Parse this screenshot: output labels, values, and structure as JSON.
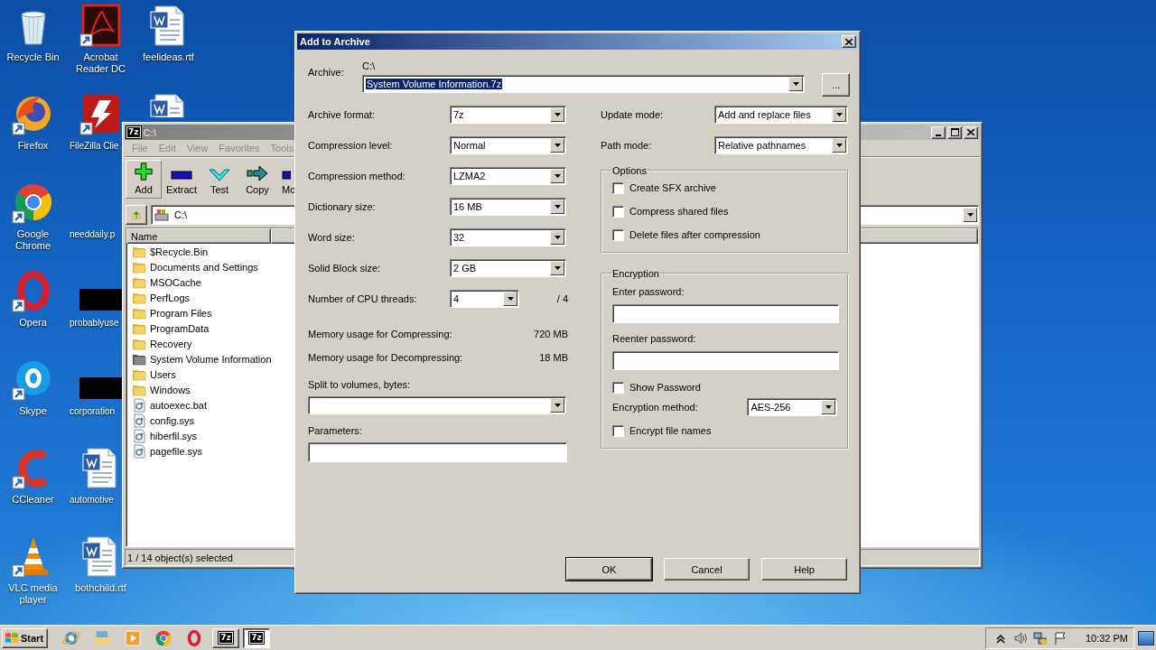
{
  "desktop_icons": [
    {
      "label": "Recycle Bin",
      "kind": "recycle-bin",
      "shortcut": false
    },
    {
      "label": "Firefox",
      "kind": "firefox",
      "shortcut": true
    },
    {
      "label": "Google Chrome",
      "kind": "chrome",
      "shortcut": true
    },
    {
      "label": "Opera",
      "kind": "opera",
      "shortcut": true
    },
    {
      "label": "Skype",
      "kind": "skype",
      "shortcut": true
    },
    {
      "label": "CCleaner",
      "kind": "ccleaner",
      "shortcut": true
    },
    {
      "label": "VLC media player",
      "kind": "vlc",
      "shortcut": true
    },
    {
      "label": "Acrobat Reader DC",
      "kind": "acrobat",
      "shortcut": true
    },
    {
      "label": "FileZilla Clie",
      "kind": "filezilla",
      "shortcut": true,
      "cut": true
    },
    {
      "label": "needdaily.p",
      "cut": true
    },
    {
      "label": "probablyuse",
      "kind": "redacted",
      "cut": true
    },
    {
      "label": "corporation",
      "kind": "redacted",
      "cut": true
    },
    {
      "label": "automotive",
      "kind": "word",
      "shortcut": false,
      "cut": true
    },
    {
      "label": "bothchild.rtf",
      "kind": "word",
      "shortcut": false
    },
    {
      "label": "feelideas.rtf",
      "kind": "word",
      "shortcut": false
    },
    {
      "kind": "word",
      "shortcut": false,
      "cut": true
    }
  ],
  "file_manager": {
    "logo": "7z",
    "title": "C:\\",
    "menu": [
      "File",
      "Edit",
      "View",
      "Favorites",
      "Tools"
    ],
    "toolbar": [
      {
        "label": "Add",
        "kind": "add",
        "selected": true
      },
      {
        "label": "Extract",
        "kind": "extract",
        "selected": false
      },
      {
        "label": "Test",
        "kind": "test",
        "selected": false
      },
      {
        "label": "Copy",
        "kind": "copy",
        "selected": false
      },
      {
        "label": "Mo",
        "kind": "move",
        "selected": false,
        "cut": true
      }
    ],
    "address": "C:\\",
    "columns": [
      "Name"
    ],
    "files": [
      {
        "name": "$Recycle.Bin",
        "kind": "folder"
      },
      {
        "name": "Documents and Settings",
        "kind": "folder"
      },
      {
        "name": "MSOCache",
        "kind": "folder"
      },
      {
        "name": "PerfLogs",
        "kind": "folder"
      },
      {
        "name": "Program Files",
        "kind": "folder"
      },
      {
        "name": "ProgramData",
        "kind": "folder"
      },
      {
        "name": "Recovery",
        "kind": "folder"
      },
      {
        "name": "System Volume Information",
        "kind": "system-folder"
      },
      {
        "name": "Users",
        "kind": "folder"
      },
      {
        "name": "Windows",
        "kind": "folder"
      },
      {
        "name": "autoexec.bat",
        "kind": "file"
      },
      {
        "name": "config.sys",
        "kind": "file"
      },
      {
        "name": "hiberfil.sys",
        "kind": "file"
      },
      {
        "name": "pagefile.sys",
        "kind": "file"
      }
    ],
    "status": "1 / 14 object(s) selected"
  },
  "dialog": {
    "title": "Add to Archive",
    "archive": {
      "label": "Archive:",
      "folder": "C:\\",
      "value": "System Volume Information.7z",
      "browse": "..."
    },
    "left_fields": [
      {
        "label": "Archive format:",
        "value": "7z"
      },
      {
        "label": "Compression level:",
        "value": "Normal"
      },
      {
        "label": "Compression method:",
        "value": "LZMA2"
      },
      {
        "label": "Dictionary size:",
        "value": "16 MB"
      },
      {
        "label": "Word size:",
        "value": "32"
      },
      {
        "label": "Solid Block size:",
        "value": "2 GB"
      },
      {
        "label": "Number of CPU threads:",
        "value": "4",
        "suffix": "/ 4"
      }
    ],
    "memory": [
      {
        "label": "Memory usage for Compressing:",
        "value": "720 MB"
      },
      {
        "label": "Memory usage for Decompressing:",
        "value": "18 MB"
      }
    ],
    "split_label": "Split to volumes, bytes:",
    "parameters_label": "Parameters:",
    "right_fields": [
      {
        "label": "Update mode:",
        "value": "Add and replace files"
      },
      {
        "label": "Path mode:",
        "value": "Relative pathnames"
      }
    ],
    "options": {
      "title": "Options",
      "items": [
        {
          "label": "Create SFX archive",
          "checked": false
        },
        {
          "label": "Compress shared files",
          "checked": false
        },
        {
          "label": "Delete files after compression",
          "checked": false
        }
      ]
    },
    "encryption": {
      "title": "Encryption",
      "password_label": "Enter password:",
      "reenter_label": "Reenter password:",
      "show_password": {
        "label": "Show Password",
        "checked": false
      },
      "method_label": "Encryption method:",
      "method": "AES-256",
      "encrypt_names": {
        "label": "Encrypt file names",
        "checked": false
      }
    },
    "buttons": [
      {
        "label": "OK",
        "selected": true
      },
      {
        "label": "Cancel",
        "selected": false
      },
      {
        "label": "Help",
        "selected": false
      }
    ]
  },
  "taskbar": {
    "start": "Start",
    "quick_launch": [
      {
        "kind": "ie"
      },
      {
        "kind": "explorer"
      },
      {
        "kind": "media-player"
      },
      {
        "kind": "chrome"
      },
      {
        "kind": "opera"
      }
    ],
    "buttons": [
      {
        "logo": "7z",
        "selected": false
      },
      {
        "logo": "7z",
        "selected": true
      }
    ],
    "tray": [
      {
        "kind": "chevron"
      },
      {
        "kind": "speaker"
      },
      {
        "kind": "network"
      },
      {
        "kind": "flag"
      }
    ],
    "clock": "10:32 PM"
  }
}
